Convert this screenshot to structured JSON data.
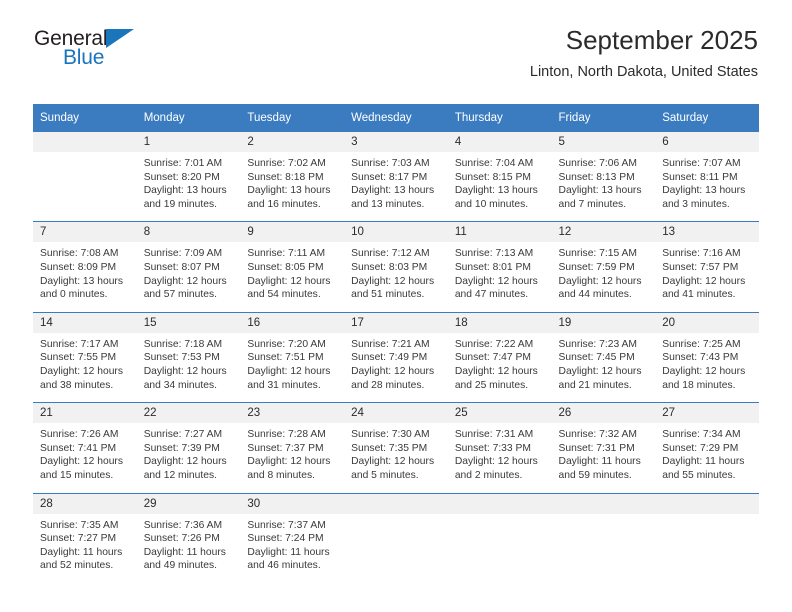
{
  "brand": {
    "name_part1": "General",
    "name_part2": "Blue",
    "accent_color": "#1b75bb"
  },
  "header": {
    "title": "September 2025",
    "subtitle": "Linton, North Dakota, United States"
  },
  "theme": {
    "header_blue": "#3b7cc0",
    "daynum_bg": "#f1f1f1",
    "text": "#2b2b2b"
  },
  "calendar": {
    "weekday_headers": [
      "Sunday",
      "Monday",
      "Tuesday",
      "Wednesday",
      "Thursday",
      "Friday",
      "Saturday"
    ],
    "weeks": [
      [
        {
          "day": "",
          "lines": []
        },
        {
          "day": "1",
          "lines": [
            "Sunrise: 7:01 AM",
            "Sunset: 8:20 PM",
            "Daylight: 13 hours",
            "and 19 minutes."
          ]
        },
        {
          "day": "2",
          "lines": [
            "Sunrise: 7:02 AM",
            "Sunset: 8:18 PM",
            "Daylight: 13 hours",
            "and 16 minutes."
          ]
        },
        {
          "day": "3",
          "lines": [
            "Sunrise: 7:03 AM",
            "Sunset: 8:17 PM",
            "Daylight: 13 hours",
            "and 13 minutes."
          ]
        },
        {
          "day": "4",
          "lines": [
            "Sunrise: 7:04 AM",
            "Sunset: 8:15 PM",
            "Daylight: 13 hours",
            "and 10 minutes."
          ]
        },
        {
          "day": "5",
          "lines": [
            "Sunrise: 7:06 AM",
            "Sunset: 8:13 PM",
            "Daylight: 13 hours",
            "and 7 minutes."
          ]
        },
        {
          "day": "6",
          "lines": [
            "Sunrise: 7:07 AM",
            "Sunset: 8:11 PM",
            "Daylight: 13 hours",
            "and 3 minutes."
          ]
        }
      ],
      [
        {
          "day": "7",
          "lines": [
            "Sunrise: 7:08 AM",
            "Sunset: 8:09 PM",
            "Daylight: 13 hours",
            "and 0 minutes."
          ]
        },
        {
          "day": "8",
          "lines": [
            "Sunrise: 7:09 AM",
            "Sunset: 8:07 PM",
            "Daylight: 12 hours",
            "and 57 minutes."
          ]
        },
        {
          "day": "9",
          "lines": [
            "Sunrise: 7:11 AM",
            "Sunset: 8:05 PM",
            "Daylight: 12 hours",
            "and 54 minutes."
          ]
        },
        {
          "day": "10",
          "lines": [
            "Sunrise: 7:12 AM",
            "Sunset: 8:03 PM",
            "Daylight: 12 hours",
            "and 51 minutes."
          ]
        },
        {
          "day": "11",
          "lines": [
            "Sunrise: 7:13 AM",
            "Sunset: 8:01 PM",
            "Daylight: 12 hours",
            "and 47 minutes."
          ]
        },
        {
          "day": "12",
          "lines": [
            "Sunrise: 7:15 AM",
            "Sunset: 7:59 PM",
            "Daylight: 12 hours",
            "and 44 minutes."
          ]
        },
        {
          "day": "13",
          "lines": [
            "Sunrise: 7:16 AM",
            "Sunset: 7:57 PM",
            "Daylight: 12 hours",
            "and 41 minutes."
          ]
        }
      ],
      [
        {
          "day": "14",
          "lines": [
            "Sunrise: 7:17 AM",
            "Sunset: 7:55 PM",
            "Daylight: 12 hours",
            "and 38 minutes."
          ]
        },
        {
          "day": "15",
          "lines": [
            "Sunrise: 7:18 AM",
            "Sunset: 7:53 PM",
            "Daylight: 12 hours",
            "and 34 minutes."
          ]
        },
        {
          "day": "16",
          "lines": [
            "Sunrise: 7:20 AM",
            "Sunset: 7:51 PM",
            "Daylight: 12 hours",
            "and 31 minutes."
          ]
        },
        {
          "day": "17",
          "lines": [
            "Sunrise: 7:21 AM",
            "Sunset: 7:49 PM",
            "Daylight: 12 hours",
            "and 28 minutes."
          ]
        },
        {
          "day": "18",
          "lines": [
            "Sunrise: 7:22 AM",
            "Sunset: 7:47 PM",
            "Daylight: 12 hours",
            "and 25 minutes."
          ]
        },
        {
          "day": "19",
          "lines": [
            "Sunrise: 7:23 AM",
            "Sunset: 7:45 PM",
            "Daylight: 12 hours",
            "and 21 minutes."
          ]
        },
        {
          "day": "20",
          "lines": [
            "Sunrise: 7:25 AM",
            "Sunset: 7:43 PM",
            "Daylight: 12 hours",
            "and 18 minutes."
          ]
        }
      ],
      [
        {
          "day": "21",
          "lines": [
            "Sunrise: 7:26 AM",
            "Sunset: 7:41 PM",
            "Daylight: 12 hours",
            "and 15 minutes."
          ]
        },
        {
          "day": "22",
          "lines": [
            "Sunrise: 7:27 AM",
            "Sunset: 7:39 PM",
            "Daylight: 12 hours",
            "and 12 minutes."
          ]
        },
        {
          "day": "23",
          "lines": [
            "Sunrise: 7:28 AM",
            "Sunset: 7:37 PM",
            "Daylight: 12 hours",
            "and 8 minutes."
          ]
        },
        {
          "day": "24",
          "lines": [
            "Sunrise: 7:30 AM",
            "Sunset: 7:35 PM",
            "Daylight: 12 hours",
            "and 5 minutes."
          ]
        },
        {
          "day": "25",
          "lines": [
            "Sunrise: 7:31 AM",
            "Sunset: 7:33 PM",
            "Daylight: 12 hours",
            "and 2 minutes."
          ]
        },
        {
          "day": "26",
          "lines": [
            "Sunrise: 7:32 AM",
            "Sunset: 7:31 PM",
            "Daylight: 11 hours",
            "and 59 minutes."
          ]
        },
        {
          "day": "27",
          "lines": [
            "Sunrise: 7:34 AM",
            "Sunset: 7:29 PM",
            "Daylight: 11 hours",
            "and 55 minutes."
          ]
        }
      ],
      [
        {
          "day": "28",
          "lines": [
            "Sunrise: 7:35 AM",
            "Sunset: 7:27 PM",
            "Daylight: 11 hours",
            "and 52 minutes."
          ]
        },
        {
          "day": "29",
          "lines": [
            "Sunrise: 7:36 AM",
            "Sunset: 7:26 PM",
            "Daylight: 11 hours",
            "and 49 minutes."
          ]
        },
        {
          "day": "30",
          "lines": [
            "Sunrise: 7:37 AM",
            "Sunset: 7:24 PM",
            "Daylight: 11 hours",
            "and 46 minutes."
          ]
        },
        {
          "day": "",
          "lines": []
        },
        {
          "day": "",
          "lines": []
        },
        {
          "day": "",
          "lines": []
        },
        {
          "day": "",
          "lines": []
        }
      ]
    ]
  }
}
